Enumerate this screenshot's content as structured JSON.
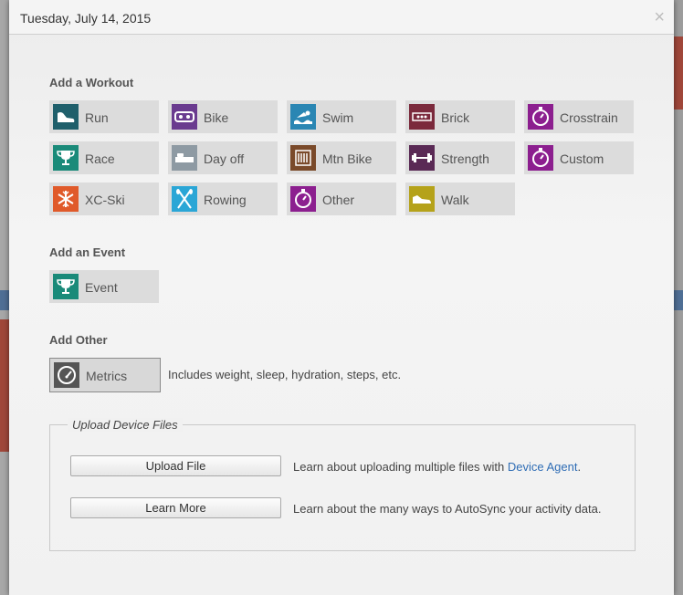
{
  "modal": {
    "date": "Tuesday, July 14, 2015",
    "close": "×"
  },
  "sections": {
    "workout_title": "Add a Workout",
    "event_title": "Add an Event",
    "other_title": "Add Other"
  },
  "workouts": [
    {
      "label": "Run",
      "icon": "shoe-icon",
      "color": "#1f5f6b"
    },
    {
      "label": "Bike",
      "icon": "bike-icon",
      "color": "#6a3b8f"
    },
    {
      "label": "Swim",
      "icon": "swim-icon",
      "color": "#2a86b3"
    },
    {
      "label": "Brick",
      "icon": "brick-icon",
      "color": "#7b2a3c"
    },
    {
      "label": "Crosstrain",
      "icon": "stopwatch-icon",
      "color": "#8c1f8f"
    },
    {
      "label": "Race",
      "icon": "trophy-icon",
      "color": "#1a8a79"
    },
    {
      "label": "Day off",
      "icon": "bed-icon",
      "color": "#8e9aa3"
    },
    {
      "label": "Mtn Bike",
      "icon": "mtn-bike-icon",
      "color": "#7a4a2a"
    },
    {
      "label": "Strength",
      "icon": "dumbbell-icon",
      "color": "#5a2a55"
    },
    {
      "label": "Custom",
      "icon": "stopwatch-icon",
      "color": "#8c1f8f"
    },
    {
      "label": "XC-Ski",
      "icon": "snowflake-icon",
      "color": "#e05a2a"
    },
    {
      "label": "Rowing",
      "icon": "oars-icon",
      "color": "#2aa6d6"
    },
    {
      "label": "Other",
      "icon": "stopwatch-icon",
      "color": "#8c1f8f"
    },
    {
      "label": "Walk",
      "icon": "sneaker-icon",
      "color": "#b5a21a"
    }
  ],
  "event": {
    "label": "Event",
    "icon": "trophy-icon",
    "color": "#1a8a79"
  },
  "metrics": {
    "label": "Metrics",
    "icon": "gauge-icon",
    "color": "#555555",
    "note": "Includes weight, sleep, hydration, steps, etc."
  },
  "upload": {
    "legend": "Upload Device Files",
    "upload_button": "Upload File",
    "upload_text": "Learn about uploading multiple files with ",
    "upload_link": "Device Agent",
    "upload_suffix": ".",
    "learn_button": "Learn More",
    "learn_text": "Learn about the many ways to AutoSync your activity data."
  }
}
